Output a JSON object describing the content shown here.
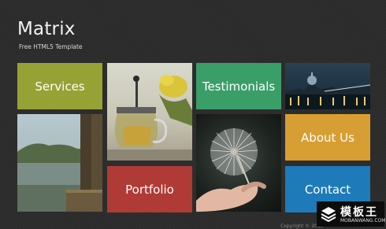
{
  "header": {
    "title": "Matrix",
    "tagline": "Free HTML5 Template"
  },
  "tiles": {
    "services": "Services",
    "testimonials": "Testimonials",
    "about": "About Us",
    "portfolio": "Portfolio",
    "contact": "Contact"
  },
  "colors": {
    "background": "#2b2b2b",
    "services": "#97a235",
    "testimonials": "#3a9e69",
    "about": "#d79e33",
    "portfolio": "#b03a35",
    "contact": "#1e7ab8"
  },
  "footer": {
    "copyright": "Copyright © 2013"
  },
  "watermark": {
    "title": "模板王",
    "subtitle": "MOBANWANG.COM"
  }
}
